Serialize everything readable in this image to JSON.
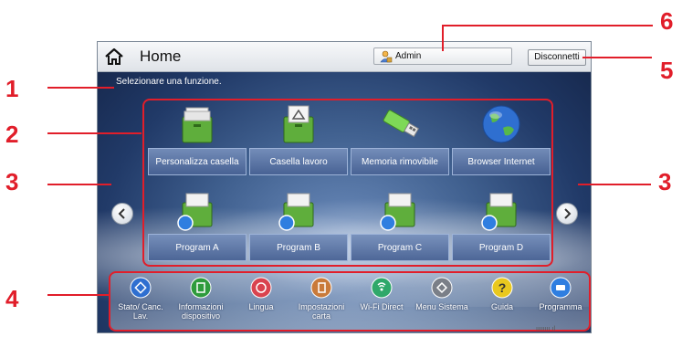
{
  "header": {
    "title": "Home",
    "admin_label": "Admin",
    "logout_label": "Disconnetti"
  },
  "subtitle": "Selezionare una funzione.",
  "functions": [
    {
      "label": "Personalizza casella",
      "icon": "custom-box-icon"
    },
    {
      "label": "Casella lavoro",
      "icon": "job-box-icon"
    },
    {
      "label": "Memoria rimovibile",
      "icon": "usb-drive-icon"
    },
    {
      "label": "Browser Internet",
      "icon": "globe-icon"
    },
    {
      "label": "Program A",
      "icon": "program-icon"
    },
    {
      "label": "Program B",
      "icon": "program-icon"
    },
    {
      "label": "Program C",
      "icon": "program-icon"
    },
    {
      "label": "Program D",
      "icon": "program-icon"
    }
  ],
  "task_bar": [
    {
      "label": "Stato/ Canc. Lav.",
      "icon": "status-icon",
      "color": "#2f6fd0"
    },
    {
      "label": "Informazioni dispositivo",
      "icon": "device-info-icon",
      "color": "#2e9b3c"
    },
    {
      "label": "Lingua",
      "icon": "language-icon",
      "color": "#d9434f"
    },
    {
      "label": "Impostazioni carta",
      "icon": "paper-settings-icon",
      "color": "#c97a3a"
    },
    {
      "label": "Wi-Fi Direct",
      "icon": "wifi-direct-icon",
      "color": "#2fa86a"
    },
    {
      "label": "Menu Sistema",
      "icon": "system-menu-icon",
      "color": "#7a7f88"
    },
    {
      "label": "Guida",
      "icon": "help-icon",
      "color": "#e9c81f"
    },
    {
      "label": "Programma",
      "icon": "program-icon",
      "color": "#2f7ee0"
    }
  ],
  "callouts": [
    "1",
    "2",
    "3",
    "3",
    "4",
    "5",
    "6"
  ],
  "corner_text": "ıııııııı ıl",
  "colors": {
    "callout": "#e11e2a"
  }
}
